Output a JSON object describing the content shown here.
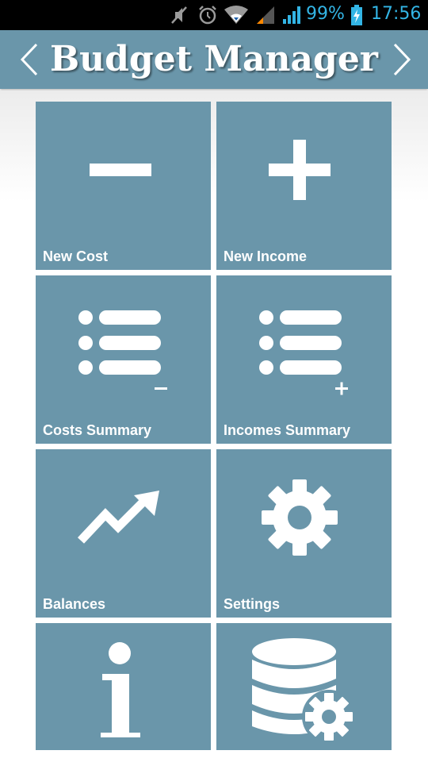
{
  "status_bar": {
    "battery_percent": "99%",
    "time": "17:56",
    "icons": [
      "mute-icon",
      "alarm-icon",
      "wifi-icon",
      "signal-weak-icon",
      "signal-strong-icon",
      "battery-charging-icon"
    ],
    "color": "#33b5e5"
  },
  "header": {
    "title": "Budget Manager",
    "background": "#6a96aa"
  },
  "tiles": [
    {
      "label": "New Cost",
      "icon": "minus-icon"
    },
    {
      "label": "New Income",
      "icon": "plus-icon"
    },
    {
      "label": "Costs Summary",
      "icon": "list-minus-icon"
    },
    {
      "label": "Incomes Summary",
      "icon": "list-plus-icon"
    },
    {
      "label": "Balances",
      "icon": "trend-up-icon"
    },
    {
      "label": "Settings",
      "icon": "gear-icon"
    },
    {
      "label": "",
      "icon": "info-icon"
    },
    {
      "label": "",
      "icon": "database-settings-icon"
    }
  ],
  "colors": {
    "tile": "#6a96aa",
    "icon": "#ffffff"
  }
}
